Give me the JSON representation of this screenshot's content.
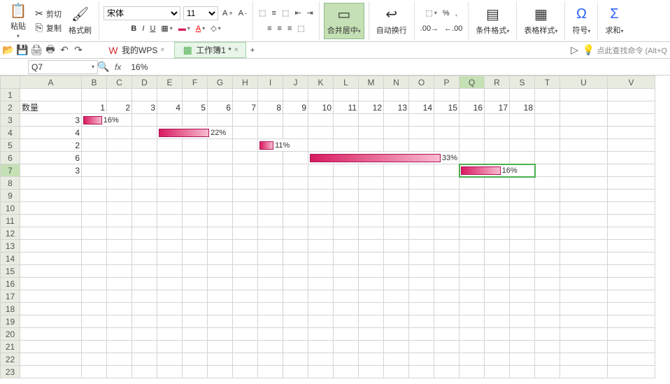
{
  "ribbon": {
    "paste": "粘贴",
    "cut": "剪切",
    "copy": "复制",
    "fmtpaint": "格式刷",
    "font": "宋体",
    "size": "11",
    "merge": "合并居中",
    "wrap": "自动换行",
    "condfmt": "条件格式",
    "tablestyle": "表格样式",
    "symbol": "符号",
    "sum": "求和"
  },
  "qat": {
    "mywps": "我的WPS",
    "book": "工作簿1 *"
  },
  "search": "点此查找命令 (Alt+Q",
  "fbar": {
    "name": "Q7",
    "val": "16%"
  },
  "cols": [
    "A",
    "B",
    "C",
    "D",
    "E",
    "F",
    "G",
    "H",
    "I",
    "J",
    "K",
    "L",
    "M",
    "N",
    "O",
    "P",
    "Q",
    "R",
    "S",
    "T",
    "U",
    "V"
  ],
  "row1": {
    "a": "数量",
    "nums": [
      "1",
      "2",
      "3",
      "4",
      "5",
      "6",
      "7",
      "8",
      "9",
      "10",
      "11",
      "12",
      "13",
      "14",
      "15",
      "16",
      "17",
      "18"
    ]
  },
  "rows": {
    "r3": {
      "a": "3",
      "lbl": "16%"
    },
    "r4": {
      "a": "4",
      "lbl": "22%"
    },
    "r5": {
      "a": "2",
      "lbl": "11%"
    },
    "r6": {
      "a": "6",
      "lbl": "33%"
    },
    "r7": {
      "a": "3",
      "lbl": "16%"
    }
  },
  "chart_data": {
    "type": "bar",
    "title": "",
    "xlabel": "",
    "ylabel": "",
    "categories": [
      "row3",
      "row4",
      "row5",
      "row6",
      "row7"
    ],
    "qty": [
      3,
      4,
      2,
      6,
      3
    ],
    "values_pct": [
      16,
      22,
      11,
      33,
      16
    ],
    "bar_start_col": [
      "B",
      "E",
      "I",
      "K",
      "Q"
    ],
    "bar_end_col": [
      "C",
      "G",
      "J",
      "P",
      "S"
    ]
  }
}
